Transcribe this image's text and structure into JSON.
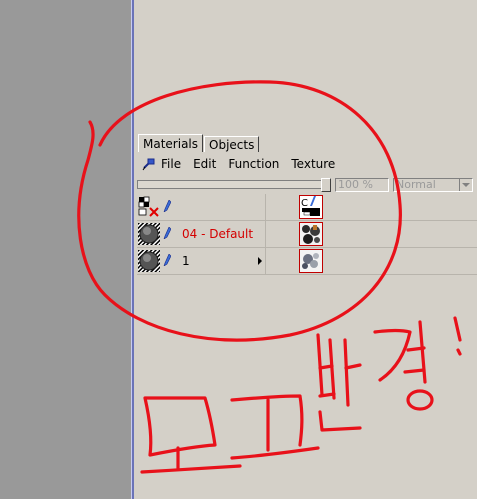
{
  "tabs": [
    {
      "label": "Materials",
      "active": true
    },
    {
      "label": "Objects",
      "active": false
    }
  ],
  "menu": [
    {
      "label": "File"
    },
    {
      "label": "Edit"
    },
    {
      "label": "Function"
    },
    {
      "label": "Texture"
    }
  ],
  "toolbar": {
    "opacity_value": "100 %",
    "blend_mode": "Normal"
  },
  "rows": [
    {
      "label": "",
      "icon": "null-object-icon",
      "thumb": "c-texture-icon"
    },
    {
      "label": "04 - Default",
      "label_color": "#d40000",
      "icon": "sphere-object-icon",
      "thumb": "texture-thumbnail-icon"
    },
    {
      "label": "1",
      "label_color": "#000000",
      "icon": "sphere-object-icon",
      "thumb": "texture-thumbnail-icon",
      "expandable": true
    }
  ],
  "annotation": {
    "color": "#e8111a",
    "handwriting": "모고 변경!"
  },
  "colors": {
    "panel_bg": "#d4d0c8",
    "left_bg": "#999999",
    "divider": "#6a73b8"
  }
}
